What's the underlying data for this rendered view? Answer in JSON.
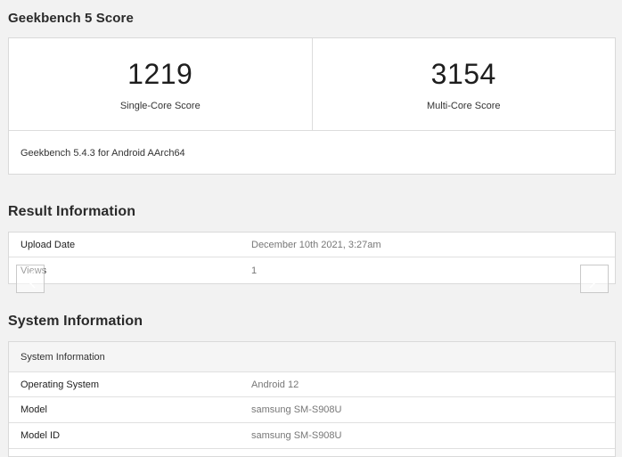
{
  "score_section": {
    "title": "Geekbench 5 Score",
    "single_core": {
      "value": "1219",
      "label": "Single-Core Score"
    },
    "multi_core": {
      "value": "3154",
      "label": "Multi-Core Score"
    },
    "version_text": "Geekbench 5.4.3 for Android AArch64"
  },
  "result_section": {
    "title": "Result Information",
    "rows": [
      {
        "key": "Upload Date",
        "value": "December 10th 2021, 3:27am"
      },
      {
        "key": "Views",
        "value": "1"
      }
    ]
  },
  "system_section": {
    "title": "System Information",
    "header": "System Information",
    "rows": [
      {
        "key": "Operating System",
        "value": "Android 12"
      },
      {
        "key": "Model",
        "value": "samsung SM-S908U"
      },
      {
        "key": "Model ID",
        "value": "samsung SM-S908U"
      }
    ]
  },
  "nav": {
    "left_icon": "chevron-left-icon",
    "right_icon": "chevron-right-icon",
    "arrow_color": "#ffffff"
  }
}
